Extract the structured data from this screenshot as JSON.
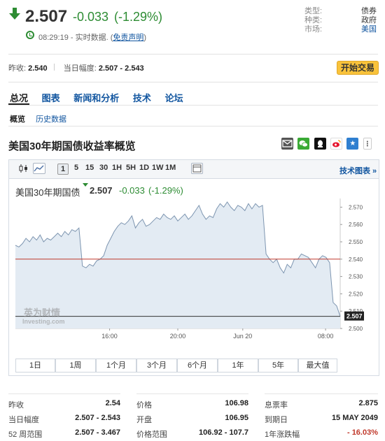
{
  "quote": {
    "last": "2.507",
    "change": "-0.033",
    "change_pct": "(-1.29%)",
    "time": "08:29:19",
    "time_note": "- 实时数据. (",
    "disclaimer": "免责声明",
    "time_close": ")"
  },
  "meta": {
    "type_label": "类型:",
    "type_val": "债券",
    "kind_label": "种类:",
    "kind_val": "政府",
    "market_label": "市场:",
    "market_val": "美国"
  },
  "prev_row": {
    "prev_label": "昨收:",
    "prev_val": "2.540",
    "range_label": "当日幅度:",
    "range_val": "2.507 - 2.543"
  },
  "trade_button": "开始交易",
  "tabs": [
    "总况",
    "图表",
    "新闻和分析",
    "技术",
    "论坛"
  ],
  "subtabs": [
    "概览",
    "历史数据"
  ],
  "section_title": "美国30年期国债收益率概览",
  "toolbar": {
    "intervals": [
      "1",
      "5",
      "15",
      "30",
      "1H",
      "5H",
      "1D",
      "1W",
      "1M"
    ],
    "advanced": "技术图表 »"
  },
  "chart_header": {
    "name": "美国30年期国债",
    "last": "2.507",
    "change": "-0.033",
    "change_pct": "(-1.29%)"
  },
  "watermark": {
    "cn": "英为财情",
    "en": "Investing.com"
  },
  "ranges": [
    "1日",
    "1周",
    "1个月",
    "3个月",
    "6个月",
    "1年",
    "5年",
    "最大值"
  ],
  "chart_data": {
    "type": "area",
    "title": "",
    "xlabel": "",
    "ylabel": "",
    "ylim": [
      2.5,
      2.575
    ],
    "y_ticks": [
      "2.570",
      "2.560",
      "2.550",
      "2.540",
      "2.530",
      "2.520",
      "2.510",
      "2.500"
    ],
    "x_ticks": [
      "16:00",
      "20:00",
      "Jun 20",
      "08:00"
    ],
    "prev_close": 2.54,
    "last_label": "2.507",
    "series": [
      {
        "values": [
          2.548,
          2.547,
          2.549,
          2.552,
          2.55,
          2.553,
          2.551,
          2.554,
          2.55,
          2.552,
          2.551,
          2.553,
          2.555,
          2.553,
          2.556,
          2.554,
          2.557,
          2.556,
          2.558,
          2.536,
          2.535,
          2.537,
          2.536,
          2.539,
          2.54,
          2.542,
          2.548,
          2.552,
          2.556,
          2.559,
          2.561,
          2.56,
          2.562,
          2.565,
          2.558,
          2.561,
          2.563,
          2.559,
          2.56,
          2.562,
          2.564,
          2.563,
          2.566,
          2.564,
          2.563,
          2.565,
          2.562,
          2.564,
          2.566,
          2.563,
          2.565,
          2.568,
          2.571,
          2.566,
          2.563,
          2.565,
          2.564,
          2.569,
          2.572,
          2.57,
          2.573,
          2.57,
          2.568,
          2.571,
          2.57,
          2.568,
          2.572,
          2.569,
          2.572,
          2.57,
          2.571,
          2.543,
          2.54,
          2.538,
          2.54,
          2.535,
          2.532,
          2.537,
          2.535,
          2.54,
          2.54,
          2.543,
          2.542,
          2.541,
          2.538,
          2.535,
          2.54,
          2.542,
          2.541,
          2.538,
          2.515,
          2.513,
          2.507
        ]
      }
    ],
    "grid": false
  },
  "stats": {
    "col1": [
      {
        "label": "昨收",
        "value": "2.54"
      },
      {
        "label": "当日幅度",
        "value": "2.507 - 2.543"
      },
      {
        "label": "52 周范围",
        "value": "2.507 - 3.467"
      }
    ],
    "col2": [
      {
        "label": "价格",
        "value": "106.98"
      },
      {
        "label": "开盘",
        "value": "106.95"
      },
      {
        "label": "价格范围",
        "value": "106.92 - 107.7"
      }
    ],
    "col3": [
      {
        "label": "息票率",
        "value": "2.875"
      },
      {
        "label": "到期日",
        "value": "15 MAY 2049"
      },
      {
        "label": "1年涨跌幅",
        "value": "- 16.03%"
      }
    ]
  },
  "colors": {
    "down_green": "#2d8c33",
    "link_blue": "#1256a0",
    "area_fill": "#e3ebf3",
    "area_line": "#7d95b0",
    "prev_close_line": "#c0392b",
    "button_yellow": "#f9c33b"
  }
}
